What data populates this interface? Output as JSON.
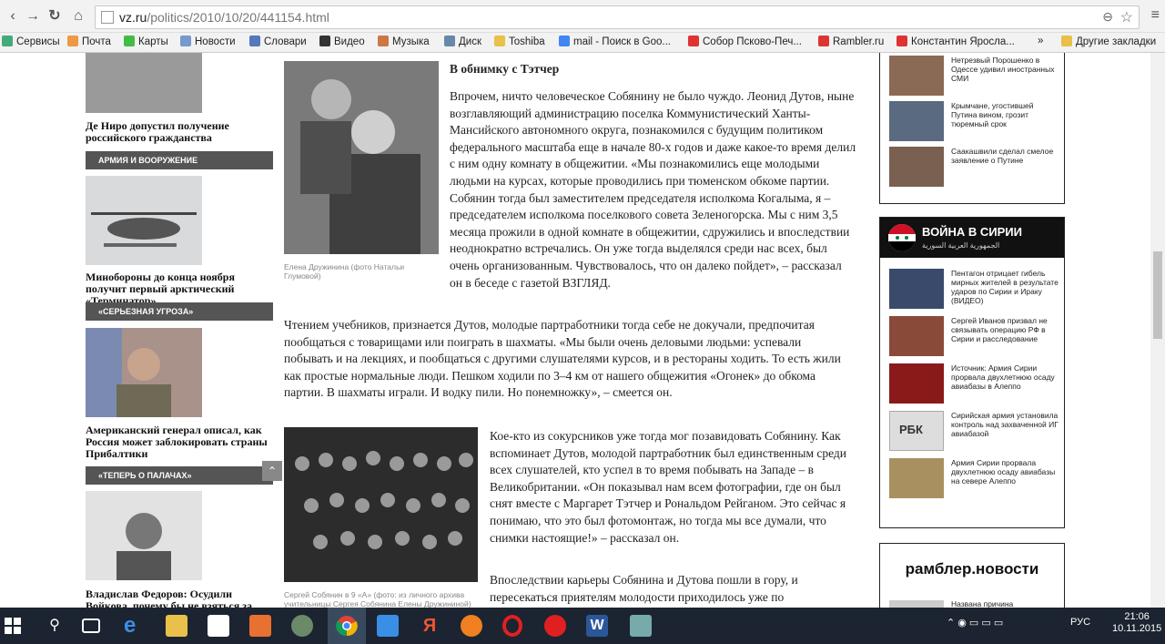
{
  "browser": {
    "url_host": "vz.ru",
    "url_path": "/politics/2010/10/20/441154.html",
    "bookmarks": [
      "Сервисы",
      "Почта",
      "Карты",
      "Новости",
      "Словари",
      "Видео",
      "Музыка",
      "Диск",
      "Toshiba",
      "mail - Поиск в Goo...",
      "Собор Псково-Печ...",
      "Rambler.ru",
      "Константин Яросла..."
    ],
    "other_bookmarks": "Другие закладки"
  },
  "left": {
    "h1": "Де Ниро допустил получение российского гражданства",
    "bar1": "АРМИЯ И ВООРУЖЕНИЕ",
    "h2": "Минобороны до конца ноября получит первый арктический «Терминатор»",
    "bar2": "«СЕРЬЕЗНАЯ УГРОЗА»",
    "h3": "Американский генерал описал, как Россия может заблокировать страны Прибалтики",
    "bar3": "«ТЕПЕРЬ О ПАЛАЧАХ»",
    "h4": "Владислав Федоров: Осудили Войкова, почему бы не взяться за"
  },
  "article": {
    "subhead": "В обнимку с Тэтчер",
    "p1": "Впрочем, ничто человеческое Собянину не было чуждо. Леонид Дутов, ныне возглавляющий администрацию поселка Коммунистический Ханты-Мансийского автономного округа, познакомился с будущим политиком федерального масштаба еще в начале 80-х годов и даже какое-то время делил с ним одну комнату в общежитии.  «Мы познакомились еще молодыми людьми на курсах, которые проводились при тюменском обкоме партии. Собянин тогда был заместителем председателя исполкома Когалыма, я – председателем исполкома поселкового совета Зеленогорска. Мы с ним 3,5 месяца прожили в одной комнате в общежитии, сдружились и впоследствии неоднократно встречались. Он уже тогда выделялся среди нас всех, был очень организованным. Чувствовалось, что он далеко пойдет», – рассказал он в беседе с газетой ВЗГЛЯД.",
    "caption1": "Елена Дружинина (фото Натальи Глумовой)",
    "p2": "Чтением учебников, признается Дутов, молодые партработники тогда себе не докучали, предпочитая пообщаться с товарищами или поиграть в шахматы. «Мы были очень деловыми людьми: успевали побывать и на лекциях, и пообщаться с другими слушателями курсов, и в рестораны ходить. То есть жили как простые нормальные люди. Пешком ходили по 3–4 км от нашего общежития «Огонек» до обкома партии. В шахматы играли. И водку пили. Но понемножку», – смеется он.",
    "p3": "Кое-кто из сокурсников уже тогда мог позавидовать Собянину. Как вспоминает Дутов, молодой партработник был единственным среди всех слушателей, кто успел в то время побывать на Западе – в Великобритании. «Он показывал нам всем фотографии, где он был снят вместе с Маргарет Тэтчер и Рональдом Рейганом. Это сейчас я понимаю, что это был фотомонтаж, но тогда мы все думали, что снимки настоящие!» – рассказал он.",
    "caption2": "Сергей Собянин в 9 «А» (фото: из личного архива учительницы Сергея Собянина Елены Дружининой)",
    "p4": "Впоследствии карьеры Собянина и Дутова пошли в гору, и пересекаться приятелям молодости приходилось уже по"
  },
  "right": {
    "news": [
      "Нетрезвый Порошенко в Одессе удивил иностранных СМИ",
      "Крымчане, угостившей Путина вином, грозит тюремный срок",
      "Саакашвили сделал смелое заявление о Путине"
    ],
    "syria_title": "ВОЙНА В СИРИИ",
    "syria_sub": "الجمهورية العربية السورية",
    "syria": [
      "Пентагон отрицает гибель мирных жителей в результате ударов по Сирии и Ираку (ВИДЕО)",
      "Сергей Иванов призвал не связывать операцию РФ в Сирии и расследование",
      "Источник: Армия Сирии прорвала двухлетнюю осаду авиабазы в Алеппо",
      "Сирийская армия установила контроль над захваченной ИГ авиабазой",
      "Армия Сирии прорвала двухлетнюю осаду авиабазы на севере Алеппо"
    ],
    "rambler_title": "рамблер.новости",
    "rambler_item": "Названа причина"
  },
  "taskbar": {
    "lang": "РУС",
    "time": "21:06",
    "date": "10.11.2015"
  }
}
